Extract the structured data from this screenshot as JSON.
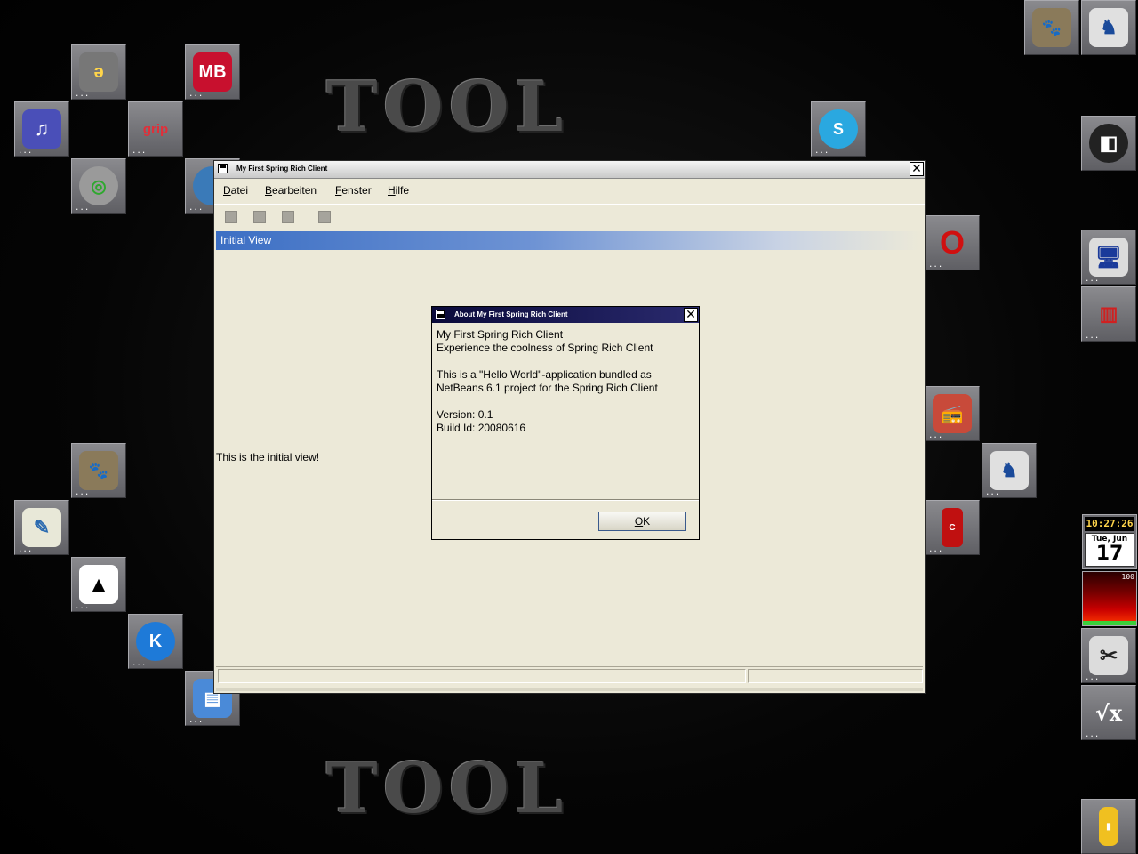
{
  "wallpaper": {
    "logo_text": "TOOL"
  },
  "window": {
    "title": "My First Spring Rich Client",
    "menus": [
      {
        "label": "Datei",
        "mnemonic": "D",
        "rest": "atei"
      },
      {
        "label": "Bearbeiten",
        "mnemonic": "B",
        "rest": "earbeiten"
      },
      {
        "label": "Fenster",
        "mnemonic": "F",
        "rest": "enster"
      },
      {
        "label": "Hilfe",
        "mnemonic": "H",
        "rest": "ilfe"
      }
    ],
    "view_title": "Initial View",
    "content_text": "This is the initial view!"
  },
  "dialog": {
    "title": "About My First Spring Rich Client",
    "lines": [
      "My First Spring Rich Client",
      "Experience the coolness of Spring Rich Client",
      "",
      "This is a \"Hello World\"-application bundled as",
      "NetBeans 6.1 project for the Spring Rich Client",
      "",
      "Version: 0.1",
      "Build Id: 20080616"
    ],
    "ok_mnemonic": "O",
    "ok_rest": "K"
  },
  "dock": {
    "clock_time": "10:27:26",
    "clock_date": "Tue, Jun",
    "clock_day": "17",
    "cpu_value": "100",
    "icon_dots": "..."
  },
  "colors": {
    "selection_blue": "#3c6fc4",
    "window_bg": "#ece9d8",
    "dialog_title": "#0a0a3a"
  }
}
